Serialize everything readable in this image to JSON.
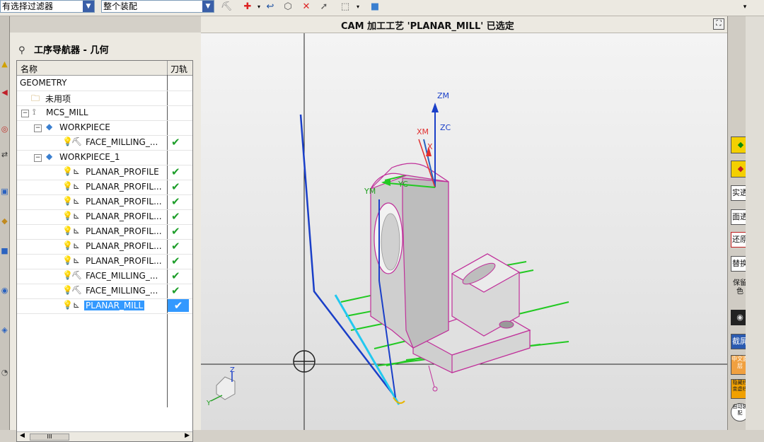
{
  "toolbar": {
    "filter_value": "有选择过滤器",
    "assembly_value": "整个装配"
  },
  "header": {
    "title": "CAM 加工工艺 'PLANAR_MILL' 已选定"
  },
  "navigator": {
    "title": "工序导航器 - 几何",
    "columns": {
      "name": "名称",
      "toolpath": "刀轨"
    },
    "rows": [
      {
        "label": "GEOMETRY",
        "check": ""
      },
      {
        "label": "未用项",
        "check": ""
      },
      {
        "label": "MCS_MILL",
        "check": ""
      },
      {
        "label": "WORKPIECE",
        "check": ""
      },
      {
        "label": "FACE_MILLING_...",
        "check": "✔"
      },
      {
        "label": "WORKPIECE_1",
        "check": ""
      },
      {
        "label": "PLANAR_PROFILE",
        "check": "✔"
      },
      {
        "label": "PLANAR_PROFIL...",
        "check": "✔"
      },
      {
        "label": "PLANAR_PROFIL...",
        "check": "✔"
      },
      {
        "label": "PLANAR_PROFIL...",
        "check": "✔"
      },
      {
        "label": "PLANAR_PROFIL...",
        "check": "✔"
      },
      {
        "label": "PLANAR_PROFIL...",
        "check": "✔"
      },
      {
        "label": "PLANAR_PROFIL...",
        "check": "✔"
      },
      {
        "label": "FACE_MILLING_...",
        "check": "✔"
      },
      {
        "label": "FACE_MILLING_...",
        "check": "✔"
      },
      {
        "label": "PLANAR_MILL",
        "check": "✔"
      }
    ],
    "scroll_label": "III"
  },
  "viewport": {
    "axes": {
      "zm": "ZM",
      "zc": "ZC",
      "xm": "XM",
      "xc": "X",
      "ym": "YM",
      "yc": "YC",
      "tri_z": "Z",
      "tri_y": "Y"
    }
  },
  "right_panel": {
    "buttons": [
      "实透",
      "面透",
      "还原",
      "替换",
      "保留色",
      "截屏",
      "中文面层",
      "隐藏线变虚线",
      "自动装配"
    ]
  },
  "colors": {
    "selection": "#3399ff",
    "check": "#1e9e2a",
    "edge": "#c0309a",
    "toolpath_blue": "#1a3fc8",
    "toolpath_cyan": "#22c8f0",
    "toolpath_green": "#22c922"
  }
}
